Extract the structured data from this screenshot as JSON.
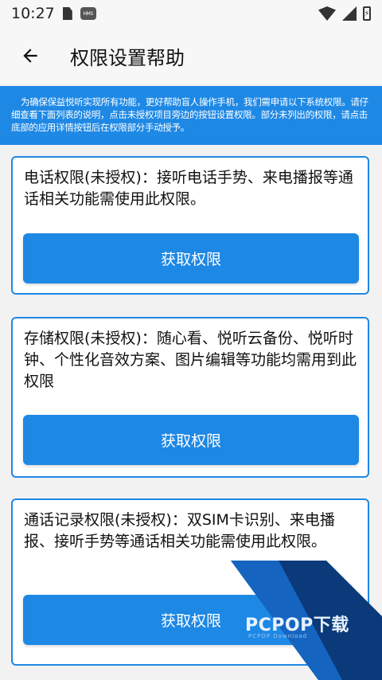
{
  "status_bar": {
    "time": "10:27",
    "hms_label": "HMS",
    "battery_glyph": "⚡"
  },
  "app_bar": {
    "title": "权限设置帮助",
    "back_icon": "arrow-left"
  },
  "info_banner": {
    "text": "为确保保益悦听实现所有功能，更好帮助盲人操作手机，我们需申请以下系统权限。请仔细查看下面列表的说明，点击未授权项目旁边的按钮设置权限。部分未列出的权限，请点击底部的应用详情按钮后在权限部分手动授予。"
  },
  "permissions": [
    {
      "description": "电话权限(未授权)：接听电话手势、来电播报等通话相关功能需使用此权限。",
      "button_label": "获取权限"
    },
    {
      "description": "存储权限(未授权)：随心看、悦听云备份、悦听时钟、个性化音效方案、图片编辑等功能均需用到此权限",
      "button_label": "获取权限"
    },
    {
      "description": "通话记录权限(未授权)：双SIM卡识别、来电播报、接听手势等通话相关功能需使用此权限。",
      "button_label": "获取权限"
    }
  ],
  "watermark": {
    "text": "PCPOP下载",
    "sub": "PCPOP Download"
  },
  "colors": {
    "accent": "#1e88e5",
    "background": "#f2f2f2"
  }
}
